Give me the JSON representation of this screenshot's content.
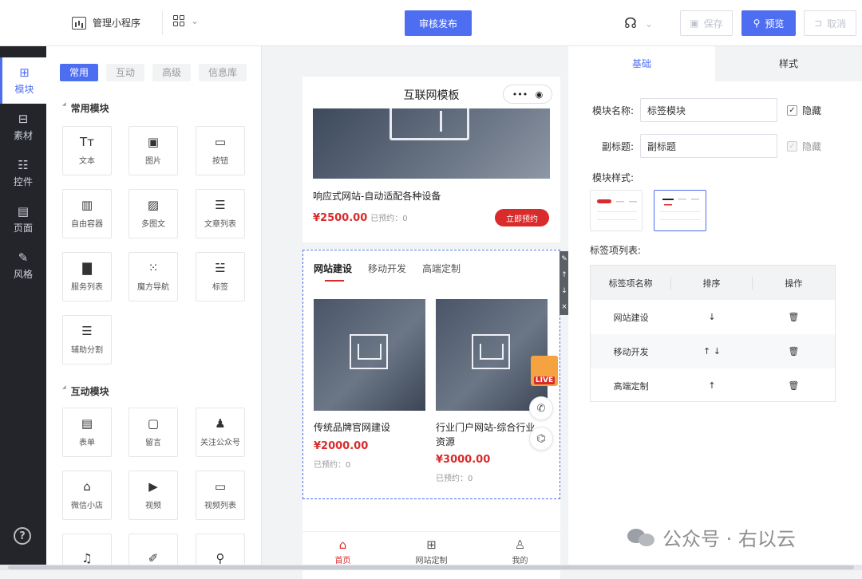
{
  "topbar": {
    "app_name": "管理小程序",
    "publish_label": "审核发布",
    "save_label": "保存",
    "preview_label": "预览",
    "cancel_label": "取消"
  },
  "leftnav": {
    "items": [
      {
        "label": "模块",
        "icon": "plus-square-icon"
      },
      {
        "label": "素材",
        "icon": "material-icon"
      },
      {
        "label": "控件",
        "icon": "sliders-icon"
      },
      {
        "label": "页面",
        "icon": "page-icon"
      },
      {
        "label": "风格",
        "icon": "wand-icon"
      }
    ]
  },
  "palette": {
    "tabs": [
      "常用",
      "互动",
      "高级",
      "信息库"
    ],
    "common_title": "常用模块",
    "common_items": [
      "文本",
      "图片",
      "按钮",
      "自由容器",
      "多图文",
      "文章列表",
      "服务列表",
      "魔方导航",
      "标签",
      "辅助分割"
    ],
    "interact_title": "互动模块",
    "interact_items": [
      "表单",
      "留言",
      "关注公众号",
      "微信小店",
      "视频",
      "视频列表"
    ]
  },
  "phone": {
    "title": "互联网模板",
    "caps_more": "•••",
    "item1_title": "响应式网站-自动适配各种设备",
    "item1_price": "¥2500.00",
    "item1_booked": "已预约：0",
    "book_label": "立即预约",
    "tabs": [
      "网站建设",
      "移动开发",
      "高端定制"
    ],
    "card1_title": "传统品牌官网建设",
    "card1_price": "¥2000.00",
    "card1_booked": "已预约：0",
    "card2_title_line1": "行业门户网站-综合行业",
    "card2_title_line2": "资源",
    "card2_price": "¥3000.00",
    "card2_booked": "已预约：0",
    "live_label": "LIVE",
    "tabbar": [
      "首页",
      "网站定制",
      "我的"
    ]
  },
  "props": {
    "tab_basic": "基础",
    "tab_style": "样式",
    "name_label": "模块名称:",
    "name_value": "标签模块",
    "hide_label": "隐藏",
    "subtitle_label": "副标题:",
    "subtitle_value": "副标题",
    "style_label": "模块样式:",
    "list_label": "标签项列表:",
    "table_headers": [
      "标签项名称",
      "排序",
      "操作"
    ],
    "rows": [
      {
        "name": "网站建设",
        "sort": "↓"
      },
      {
        "name": "移动开发",
        "sort": "↑ ↓"
      },
      {
        "name": "高端定制",
        "sort": "↑"
      }
    ]
  },
  "watermark": {
    "text": "公众号 · 右以云"
  },
  "colors": {
    "accent": "#4e6ef2",
    "price_red": "#d92b2b",
    "nav_dark": "#23252b"
  }
}
